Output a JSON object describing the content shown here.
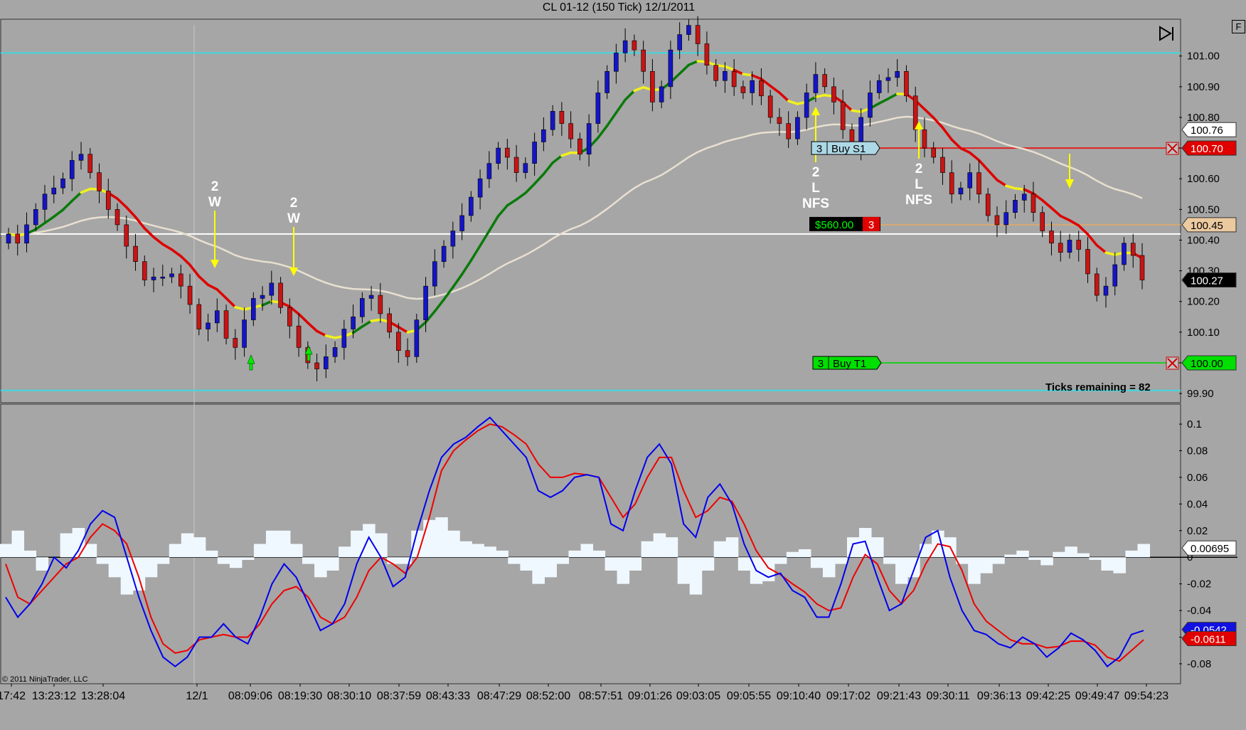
{
  "window": {
    "title": "CL 01-12 (150 Tick)  12/1/2011",
    "corner_button": "F"
  },
  "chart_data": {
    "type": "candlestick",
    "title": "CL 01-12 (150 Tick)  12/1/2011",
    "price_axis": {
      "ticks": [
        {
          "v": 101.0,
          "label": "101.00"
        },
        {
          "v": 100.9,
          "label": "100.90"
        },
        {
          "v": 100.8,
          "label": "100.80"
        },
        {
          "v": 100.7,
          "label": "100.70"
        },
        {
          "v": 100.6,
          "label": "100.60"
        },
        {
          "v": 100.5,
          "label": "100.50"
        },
        {
          "v": 100.4,
          "label": "100.40"
        },
        {
          "v": 100.3,
          "label": "100.30"
        },
        {
          "v": 100.2,
          "label": "100.20"
        },
        {
          "v": 100.1,
          "label": "100.10"
        },
        {
          "v": 100.0,
          "label": "100.00"
        },
        {
          "v": 99.9,
          "label": "99.90"
        }
      ],
      "ylim": [
        99.87,
        101.12
      ]
    },
    "price_markers": [
      {
        "v": 100.76,
        "label": "100.76",
        "style": "white"
      },
      {
        "v": 100.7,
        "label": "100.70",
        "style": "red"
      },
      {
        "v": 100.45,
        "label": "100.45",
        "style": "tan"
      },
      {
        "v": 100.27,
        "label": "100.27",
        "style": "black"
      },
      {
        "v": 100.0,
        "label": "100.00",
        "style": "green"
      }
    ],
    "x_axis_labels": [
      "17:42",
      "13:23:12",
      "13:28:04",
      "12/1",
      "08:09:06",
      "08:19:30",
      "08:30:10",
      "08:37:59",
      "08:43:33",
      "08:47:29",
      "08:52:00",
      "08:57:51",
      "09:01:26",
      "09:03:05",
      "09:05:55",
      "09:10:40",
      "09:17:02",
      "09:21:43",
      "09:30:11",
      "09:36:13",
      "09:42:25",
      "09:49:47",
      "09:54:23"
    ],
    "bars_close": [
      100.42,
      100.39,
      100.45,
      100.5,
      100.55,
      100.57,
      100.6,
      100.66,
      100.68,
      100.62,
      100.56,
      100.5,
      100.45,
      100.38,
      100.33,
      100.27,
      100.28,
      100.28,
      100.29,
      100.25,
      100.19,
      100.11,
      100.13,
      100.17,
      100.08,
      100.05,
      100.14,
      100.21,
      100.22,
      100.26,
      100.18,
      100.12,
      100.05,
      100.0,
      99.98,
      100.02,
      100.05,
      100.11,
      100.15,
      100.21,
      100.22,
      100.16,
      100.1,
      100.04,
      100.02,
      100.14,
      100.25,
      100.33,
      100.38,
      100.43,
      100.48,
      100.54,
      100.6,
      100.65,
      100.7,
      100.67,
      100.62,
      100.65,
      100.72,
      100.76,
      100.82,
      100.78,
      100.73,
      100.68,
      100.78,
      100.88,
      100.95,
      101.01,
      101.05,
      101.02,
      100.95,
      100.85,
      100.9,
      101.02,
      101.07,
      101.1,
      101.04,
      100.97,
      100.92,
      100.95,
      100.9,
      100.88,
      100.92,
      100.87,
      100.8,
      100.78,
      100.73,
      100.8,
      100.88,
      100.94,
      100.9,
      100.85,
      100.76,
      100.7,
      100.8,
      100.88,
      100.92,
      100.93,
      100.95,
      100.87,
      100.76,
      100.7,
      100.67,
      100.62,
      100.55,
      100.57,
      100.62,
      100.55,
      100.48,
      100.45,
      100.49,
      100.53,
      100.55,
      100.49,
      100.43,
      100.39,
      100.36,
      100.4,
      100.37,
      100.29,
      100.22,
      100.25,
      100.32,
      100.39,
      100.35,
      100.27
    ],
    "moving_averages": [
      {
        "name": "fast-ma",
        "colors": [
          "#dd0000",
          "#f0f020",
          "#0a7a0a"
        ]
      },
      {
        "name": "slow-ma",
        "color": "#e8e0d0"
      }
    ],
    "horizontal_lines": [
      {
        "v": 101.01,
        "color": "#40d8e0"
      },
      {
        "v": 99.91,
        "color": "#40d8e0"
      },
      {
        "v": 100.42,
        "color": "#ffffff"
      },
      {
        "v": 100.7,
        "color": "#e02020"
      },
      {
        "v": 100.45,
        "color": "#d8a870"
      },
      {
        "v": 100.0,
        "color": "#20cc20"
      }
    ],
    "annotations": [
      {
        "lines": [
          "2",
          "W"
        ]
      },
      {
        "lines": [
          "2",
          "W"
        ]
      },
      {
        "lines": [
          "2",
          "L",
          "NFS"
        ]
      },
      {
        "lines": [
          "2",
          "L",
          "NFS"
        ]
      }
    ],
    "orders": [
      {
        "qty": "3",
        "label": "Buy S1",
        "price": 100.7
      },
      {
        "qty": "3",
        "label": "Buy T1",
        "price": 100.0
      }
    ],
    "position": {
      "pnl": "$560.00",
      "qty": "3",
      "price": 100.45
    },
    "ticks_remaining": "Ticks remaining = 82",
    "indicator": {
      "axis_ticks": [
        {
          "v": 0.1,
          "label": "0.1"
        },
        {
          "v": 0.08,
          "label": "0.08"
        },
        {
          "v": 0.06,
          "label": "0.06"
        },
        {
          "v": 0.04,
          "label": "0.04"
        },
        {
          "v": 0.02,
          "label": "0.02"
        },
        {
          "v": 0,
          "label": "0"
        },
        {
          "v": -0.02,
          "label": "-0.02"
        },
        {
          "v": -0.04,
          "label": "-0.04"
        },
        {
          "v": -0.06,
          "label": "-0.06"
        },
        {
          "v": -0.08,
          "label": "-0.08"
        }
      ],
      "ylim": [
        -0.095,
        0.115
      ],
      "markers": [
        {
          "v": 0.00695,
          "label": "0.00695",
          "style": "white"
        },
        {
          "v": -0.0542,
          "label": "-0.0542",
          "style": "blue"
        },
        {
          "v": -0.0611,
          "label": "-0.0611",
          "style": "red"
        }
      ],
      "blue_line": [
        -0.03,
        -0.045,
        -0.035,
        -0.02,
        0.0,
        -0.008,
        0.005,
        0.025,
        0.035,
        0.03,
        0.0,
        -0.03,
        -0.055,
        -0.075,
        -0.082,
        -0.075,
        -0.06,
        -0.06,
        -0.05,
        -0.06,
        -0.065,
        -0.045,
        -0.02,
        -0.005,
        -0.015,
        -0.035,
        -0.055,
        -0.05,
        -0.035,
        -0.005,
        0.015,
        0.0,
        -0.022,
        -0.015,
        0.02,
        0.05,
        0.075,
        0.085,
        0.09,
        0.098,
        0.105,
        0.095,
        0.085,
        0.075,
        0.05,
        0.045,
        0.05,
        0.06,
        0.062,
        0.06,
        0.025,
        0.02,
        0.05,
        0.075,
        0.085,
        0.07,
        0.025,
        0.015,
        0.045,
        0.055,
        0.04,
        0.01,
        -0.01,
        -0.015,
        -0.012,
        -0.025,
        -0.03,
        -0.045,
        -0.045,
        -0.02,
        0.01,
        0.012,
        -0.015,
        -0.04,
        -0.035,
        -0.01,
        0.015,
        0.02,
        -0.015,
        -0.04,
        -0.055,
        -0.058,
        -0.065,
        -0.068,
        -0.06,
        -0.065,
        -0.075,
        -0.068,
        -0.057,
        -0.062,
        -0.07,
        -0.082,
        -0.075,
        -0.058,
        -0.055
      ],
      "red_line": [
        -0.005,
        -0.03,
        -0.035,
        -0.025,
        -0.015,
        -0.005,
        0.0,
        0.015,
        0.025,
        0.02,
        0.01,
        -0.015,
        -0.045,
        -0.065,
        -0.072,
        -0.07,
        -0.062,
        -0.06,
        -0.058,
        -0.06,
        -0.06,
        -0.05,
        -0.035,
        -0.025,
        -0.022,
        -0.03,
        -0.045,
        -0.05,
        -0.045,
        -0.03,
        -0.01,
        0.0,
        -0.005,
        -0.012,
        0.0,
        0.03,
        0.065,
        0.08,
        0.088,
        0.095,
        0.1,
        0.098,
        0.092,
        0.085,
        0.07,
        0.06,
        0.06,
        0.063,
        0.062,
        0.06,
        0.045,
        0.03,
        0.04,
        0.06,
        0.075,
        0.075,
        0.05,
        0.03,
        0.035,
        0.045,
        0.042,
        0.025,
        0.005,
        -0.008,
        -0.013,
        -0.02,
        -0.026,
        -0.035,
        -0.04,
        -0.038,
        -0.015,
        0.002,
        -0.005,
        -0.025,
        -0.035,
        -0.025,
        -0.005,
        0.01,
        0.008,
        -0.01,
        -0.035,
        -0.048,
        -0.055,
        -0.062,
        -0.065,
        -0.065,
        -0.068,
        -0.067,
        -0.063,
        -0.063,
        -0.066,
        -0.075,
        -0.078,
        -0.07,
        -0.062
      ],
      "histogram": [
        0.01,
        0.02,
        0.005,
        -0.01,
        0.0,
        0.018,
        0.022,
        0.01,
        -0.005,
        -0.015,
        -0.028,
        -0.025,
        -0.015,
        -0.005,
        0.01,
        0.018,
        0.015,
        0.005,
        -0.005,
        -0.008,
        -0.002,
        0.01,
        0.02,
        0.02,
        0.01,
        -0.005,
        -0.015,
        -0.01,
        0.008,
        0.02,
        0.025,
        0.018,
        -0.005,
        -0.005,
        0.02,
        0.028,
        0.03,
        0.02,
        0.012,
        0.01,
        0.008,
        0.005,
        -0.005,
        -0.01,
        -0.02,
        -0.015,
        -0.005,
        0.005,
        0.01,
        0.005,
        -0.01,
        -0.02,
        -0.01,
        0.012,
        0.018,
        0.015,
        -0.02,
        -0.028,
        -0.01,
        0.012,
        0.015,
        -0.01,
        -0.02,
        -0.018,
        -0.005,
        0.004,
        0.006,
        -0.008,
        -0.015,
        -0.005,
        0.015,
        0.022,
        0.015,
        -0.005,
        -0.02,
        -0.015,
        0.01,
        0.02,
        0.015,
        -0.005,
        -0.02,
        -0.012,
        -0.005,
        0.002,
        0.005,
        -0.002,
        -0.006,
        0.004,
        0.008,
        0.003,
        -0.002,
        -0.01,
        -0.012,
        0.005,
        0.01
      ]
    }
  },
  "copyright": "© 2011 NinjaTrader, LLC"
}
